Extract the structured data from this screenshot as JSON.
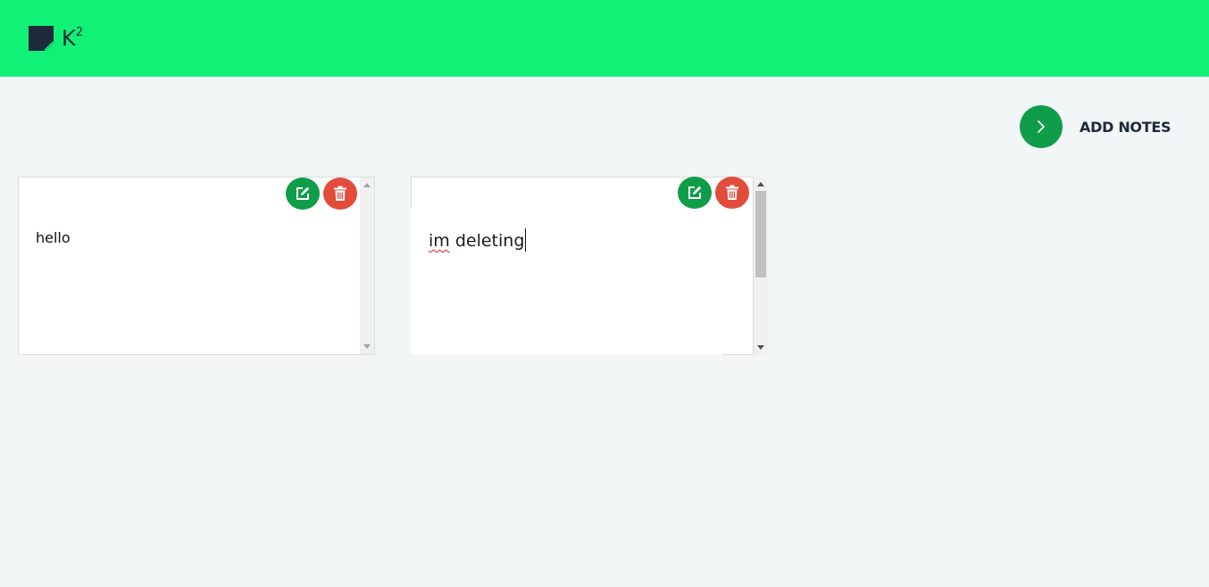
{
  "header": {
    "brand": "K",
    "brand_sup": "2",
    "bg_color": "#10f176"
  },
  "toolbar": {
    "add_notes_label": "ADD NOTES",
    "add_icon": "chevron-right-icon",
    "accent": "#0f9d49"
  },
  "notes": [
    {
      "text": "hello",
      "edit_icon": "edit-icon",
      "delete_icon": "trash-icon"
    },
    {
      "text_misspelled": "im",
      "text_rest": " deleting",
      "edit_icon": "edit-icon",
      "delete_icon": "trash-icon"
    }
  ],
  "colors": {
    "edit": "#0f9d49",
    "delete": "#e34b3b",
    "background": "#f2f6f7"
  }
}
